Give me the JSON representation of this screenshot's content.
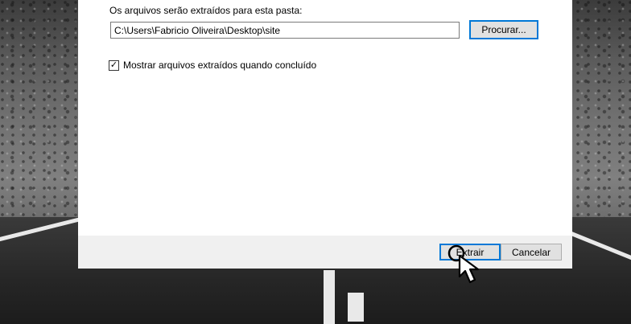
{
  "dialog": {
    "folder_label": "Os arquivos serão extraídos para esta pasta:",
    "path_value": "C:\\Users\\Fabricio Oliveira\\Desktop\\site",
    "browse_label": "Procurar...",
    "show_files_label": "Mostrar arquivos extraídos quando concluído",
    "show_files_checked": true,
    "extract_label": "Extrair",
    "cancel_label": "Cancelar"
  },
  "colors": {
    "focus_accent": "#0078d7",
    "footer_bg": "#f0f0f0",
    "button_bg": "#e1e1e1"
  },
  "icons": {
    "checkbox_mark": "✓",
    "cursor": "hand-pointer-cursor-icon"
  }
}
